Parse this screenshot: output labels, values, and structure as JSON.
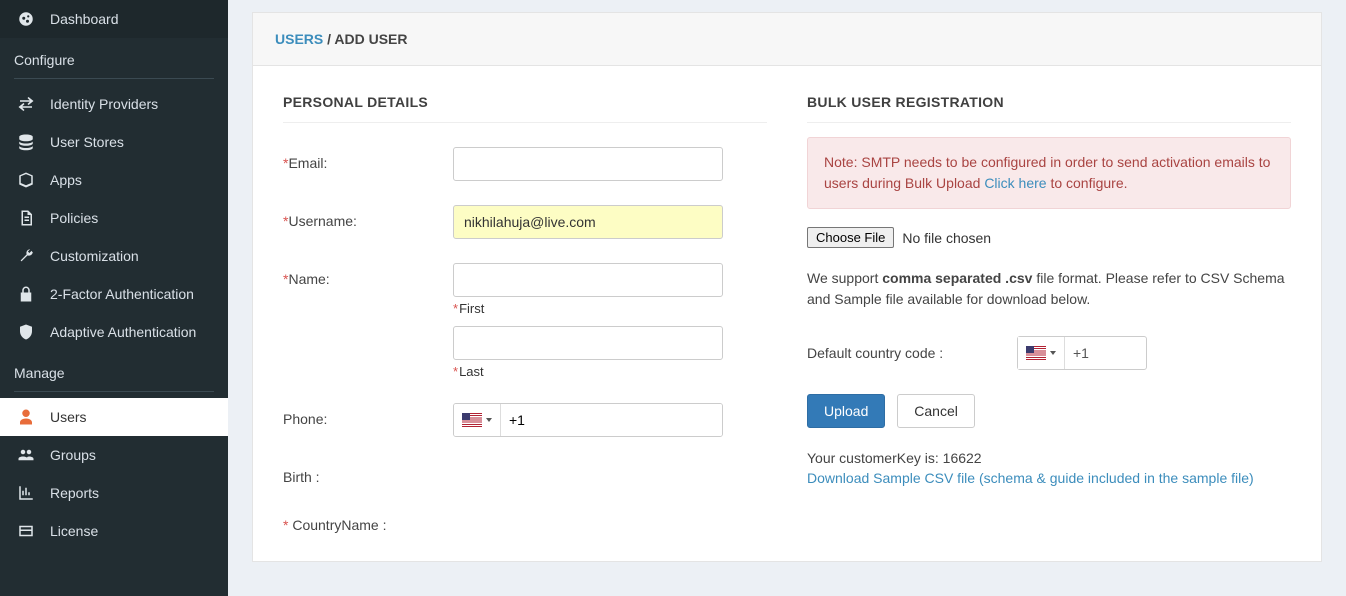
{
  "sidebar": {
    "dashboard": "Dashboard",
    "section_configure": "Configure",
    "identity_providers": "Identity Providers",
    "user_stores": "User Stores",
    "apps": "Apps",
    "policies": "Policies",
    "customization": "Customization",
    "two_factor": "2-Factor Authentication",
    "adaptive_auth": "Adaptive Authentication",
    "section_manage": "Manage",
    "users": "Users",
    "groups": "Groups",
    "reports": "Reports",
    "license": "License"
  },
  "breadcrumb": {
    "users": "USERS",
    "sep": " / ",
    "add_user": "ADD USER"
  },
  "personal": {
    "title": "PERSONAL DETAILS",
    "email_label": "Email:",
    "username_label": "Username:",
    "username_value": "nikhilahuja@live.com",
    "name_label": "Name:",
    "first_label": "First",
    "last_label": "Last",
    "phone_label": "Phone:",
    "phone_code": "+1",
    "birth_label": "Birth :",
    "country_label": " CountryName :"
  },
  "bulk": {
    "title": "BULK USER REGISTRATION",
    "note_prefix": "Note: SMTP needs to be configured in order to send activation emails to users during Bulk Upload ",
    "note_link": "Click here",
    "note_suffix": " to configure.",
    "choose_file": "Choose File",
    "no_file": "No file chosen",
    "support_prefix": "We support ",
    "support_bold": "comma separated .csv",
    "support_suffix": " file format. Please refer to CSV Schema and Sample file available for download below.",
    "default_cc_label": "Default country code :",
    "default_cc_value": "+1",
    "upload": "Upload",
    "cancel": "Cancel",
    "customer_key_label": "Your customerKey is: ",
    "customer_key_value": "16622",
    "download_link": "Download Sample CSV file (schema & guide included in the sample file)"
  }
}
